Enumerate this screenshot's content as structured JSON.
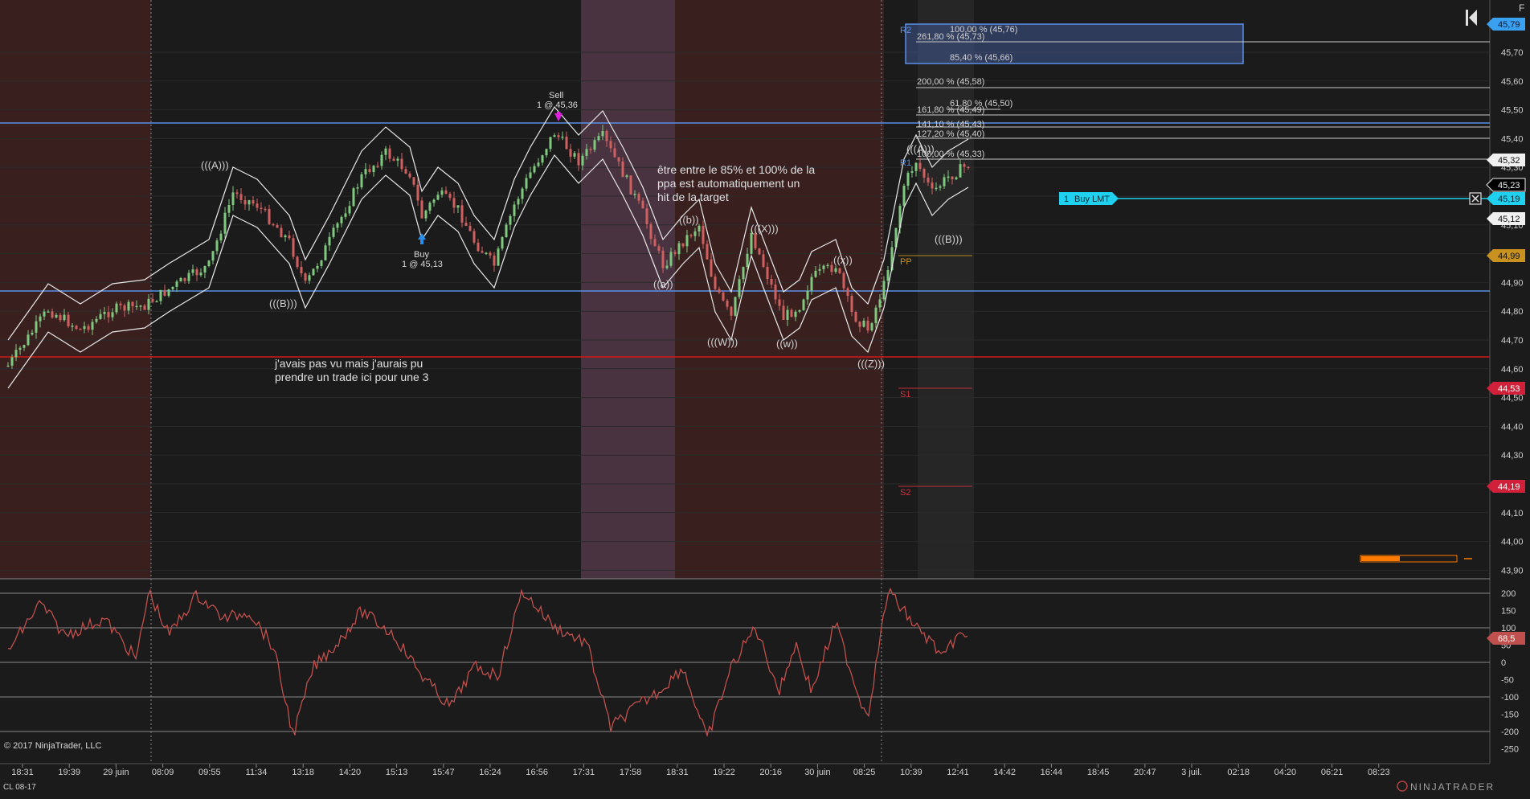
{
  "instrument": "CL 08-17",
  "copyright": "© 2017 NinjaTrader, LLC",
  "brand": "NINJATRADER",
  "window_button": "F",
  "colors": {
    "background": "#1b1b1b",
    "session_shade": "#3a1f1f",
    "session_shade_highlight": "#4a3340",
    "blue_line": "#5b8fe6",
    "red_line": "#d01a1a",
    "cyan": "#1fd1ee",
    "candle_up": "#7fc97f",
    "candle_down": "#d06060",
    "oscillator": "#c0504d"
  },
  "x_axis_labels": [
    "18:31",
    "19:39",
    "29 juin",
    "08:09",
    "09:55",
    "11:34",
    "13:18",
    "14:20",
    "15:13",
    "15:47",
    "16:24",
    "16:56",
    "17:31",
    "17:58",
    "18:31",
    "19:22",
    "20:16",
    "30 juin",
    "08:25",
    "10:39",
    "12:41",
    "14:42",
    "16:44",
    "18:45",
    "20:47",
    "3 juil.",
    "02:18",
    "04:20",
    "06:21",
    "08:23"
  ],
  "price_axis": [
    "45,70",
    "45,60",
    "45,50",
    "45,40",
    "45,30",
    "45,20",
    "45,10",
    "45,00",
    "44,90",
    "44,80",
    "44,70",
    "44,60",
    "44,50",
    "44,40",
    "44,30",
    "44,20",
    "44,10",
    "44,00",
    "43,90"
  ],
  "osc_axis": [
    "200",
    "150",
    "100",
    "50",
    "0",
    "-50",
    "-100",
    "-150",
    "-200",
    "-250"
  ],
  "price_tags": [
    {
      "label": "45,79",
      "kind": "blue"
    },
    {
      "label": "45,32",
      "kind": "white"
    },
    {
      "label": "45,23",
      "kind": "black"
    },
    {
      "label": "45,19",
      "kind": "cyan"
    },
    {
      "label": "45,12",
      "kind": "white"
    },
    {
      "label": "44,99",
      "kind": "gold"
    },
    {
      "label": "44,53",
      "kind": "red"
    },
    {
      "label": "44,19",
      "kind": "red"
    },
    {
      "label": "68,5",
      "kind": "osc"
    }
  ],
  "fib_labels": [
    "100,00 % (45,76)",
    "261,80 % (45,73)",
    "85,40 % (45,66)",
    "200,00 % (45,58)",
    "161,80 % (45,49)",
    "61,80 % (45,50)",
    "141,10 % (45,43)",
    "127,20 % (45,40)",
    "100,00 % (45,33)"
  ],
  "pivot_labels": [
    "R2",
    "R1",
    "PP",
    "S1",
    "S2"
  ],
  "wave_labels": [
    "(((A)))",
    "(((B)))",
    "((a))",
    "((b))",
    "(((W)))",
    "(((X)))",
    "((w))",
    "((x))",
    "(((Z)))",
    "(((A)))",
    "(((B)))"
  ],
  "trades": {
    "sell_title": "Sell",
    "sell_detail": "1 @ 45,36",
    "buy_title": "Buy",
    "buy_detail": "1 @ 45,13"
  },
  "order": {
    "qty": "1",
    "label": "Buy LMT"
  },
  "notes": {
    "note1_line1": "être entre le 85% et 100% de la",
    "note1_line2": "ppa est automatiquement un",
    "note1_line3": "hit de la target",
    "note2_line1": "j'avais pas vu mais j'aurais pu",
    "note2_line2": "prendre un trade ici pour une 3"
  }
}
